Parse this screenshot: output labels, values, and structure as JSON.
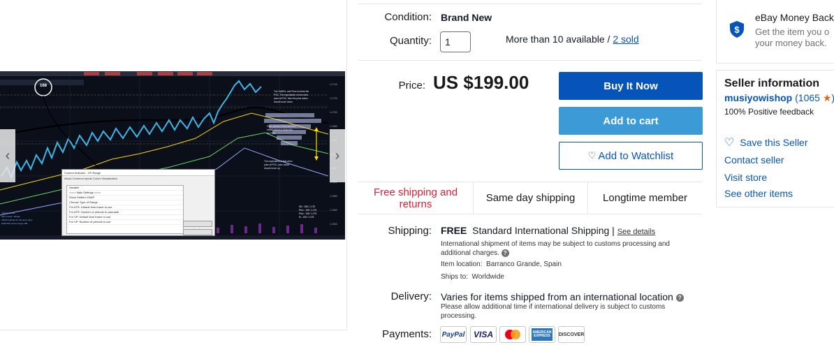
{
  "condition": {
    "label": "Condition:",
    "value": "Brand New"
  },
  "quantity": {
    "label": "Quantity:",
    "value": "1",
    "available": "More than 10 available / ",
    "sold": "2 sold"
  },
  "price": {
    "label": "Price:",
    "value": "US $199.00"
  },
  "buttons": {
    "buy_now": "Buy It Now",
    "add_to_cart": "Add to cart",
    "watchlist": "Add to Watchlist"
  },
  "features": [
    "Free shipping and returns",
    "Same day shipping",
    "Longtime member"
  ],
  "shipping": {
    "label": "Shipping:",
    "free": "FREE",
    "method": "Standard International Shipping",
    "details_link": "See details",
    "note": "International shipment of items may be subject to customs processing and additional charges.",
    "location_label": "Item location:",
    "location": "Barranco Grande, Spain",
    "ships_to_label": "Ships to:",
    "ships_to": "Worldwide"
  },
  "delivery": {
    "label": "Delivery:",
    "text": "Varies for items shipped from an international location",
    "note": "Please allow additional time if international delivery is subject to customs processing."
  },
  "payments": {
    "label": "Payments:",
    "methods": [
      "PayPal",
      "VISA",
      "Mastercard",
      "American Express",
      "DISCOVER"
    ]
  },
  "money_back": {
    "title": "eBay Money Back",
    "line1": "Get the item you o",
    "line2": "your money back."
  },
  "seller": {
    "heading": "Seller information",
    "name": "musiyowishop",
    "score": "1065",
    "feedback": "100% Positive feedback",
    "save": "Save this Seller",
    "contact": "Contact seller",
    "visit": "Visit store",
    "other": "See other items"
  },
  "image": {
    "annotation_number": "168",
    "dialog_title": "Custom Indicator - VP-Range",
    "dialog_tabs": "About   Common   Inputs   Colors   Visualization",
    "dialog_rows": [
      "Variable",
      "==== Main Settings ====",
      "Show Shifted VWAP",
      "Choose Type of Range",
      "For ATR: Default time frame to use",
      "For ATR: Number of periods to calculate",
      "For VP: Default time frame to use",
      "For VP: Number of periods to use"
    ],
    "dialog_buttons": [
      "Load",
      "Save"
    ],
    "note1": "The VWAPs, and Price is below the POC. The expectation is that when price at POC, then the price action should move down.",
    "note2": "Price volume (SVA) has been traded above or below the the POC.",
    "note3": "The expectation is that when price at POC, price action should move up."
  },
  "colors": {
    "accent": "#0654ba",
    "cart": "#3c9bd6",
    "red": "#dd1e31",
    "star": "#e0661f"
  }
}
